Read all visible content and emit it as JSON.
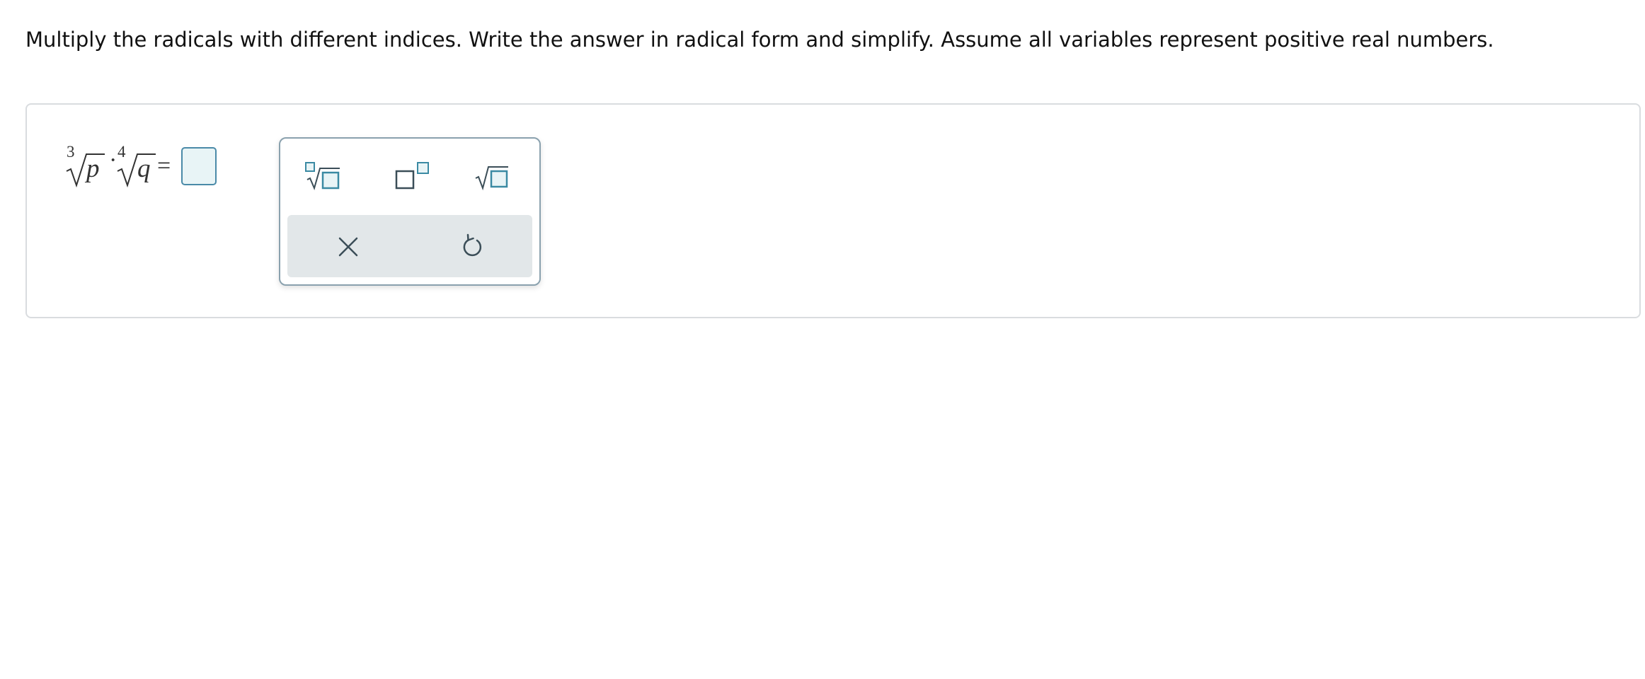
{
  "instructions": "Multiply the radicals with different indices. Write the answer in radical form and simplify. Assume all variables represent positive real numbers.",
  "expression": {
    "first_index": "3",
    "first_radicand": "p",
    "dot": "·",
    "second_index": "4",
    "second_radicand": "q",
    "equals": "="
  },
  "answer": {
    "value": ""
  },
  "palette": {
    "tools": [
      {
        "name": "nth-root-icon"
      },
      {
        "name": "exponent-icon"
      },
      {
        "name": "square-root-icon"
      }
    ],
    "actions": [
      {
        "name": "clear-icon"
      },
      {
        "name": "undo-icon"
      }
    ]
  },
  "colors": {
    "accent": "#4a8aa8",
    "answer_fill": "#e8f4f6",
    "icon_dark": "#3b4e58",
    "action_bar": "#e2e7e9"
  }
}
